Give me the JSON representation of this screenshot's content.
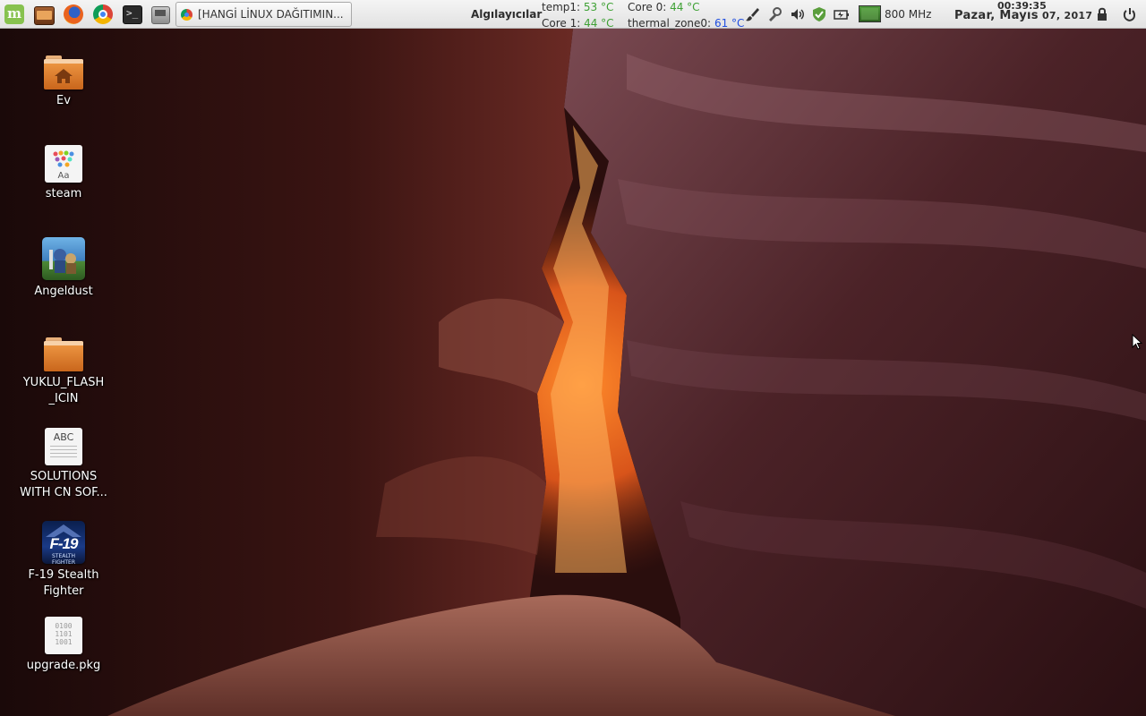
{
  "panel": {
    "launchers": [
      {
        "icon": "mint-menu-icon"
      },
      {
        "icon": "files-icon"
      },
      {
        "icon": "firefox-icon"
      },
      {
        "icon": "chrome-icon"
      },
      {
        "icon": "terminal-icon"
      },
      {
        "icon": "disk-icon"
      }
    ],
    "task": {
      "icon": "chrome-icon",
      "label": "[HANGİ LİNUX DAĞITIMIN..."
    },
    "sensors": {
      "title": "Algılayıcılar",
      "items": [
        {
          "name": "temp1:",
          "value": "53 °C",
          "color": "#3fa135"
        },
        {
          "name": "Core 1:",
          "value": "44 °C",
          "color": "#3fa135"
        },
        {
          "name": "Core 0:",
          "value": "44 °C",
          "color": "#3fa135"
        },
        {
          "name": "thermal_zone0:",
          "value": "61 °C",
          "color": "#1f4ee0"
        }
      ]
    },
    "tray": [
      "brush-icon",
      "settings-icon",
      "volume-icon",
      "shield-icon",
      "battery-icon",
      "cpu-graph-icon"
    ],
    "cpu_freq": "800 MHz",
    "clock": {
      "time": "00:39:35",
      "date_main": "Pazar, Mayıs",
      "date_small": " 07, 2017"
    },
    "end_icons": [
      "lock-icon",
      "power-icon"
    ]
  },
  "desktop": {
    "items": [
      {
        "label": "Ev",
        "icon": "home-folder-icon"
      },
      {
        "label": "steam",
        "icon": "font-file-icon",
        "icon_text": "Aa"
      },
      {
        "label": "Angeldust",
        "icon": "angeldust-icon"
      },
      {
        "label": "YUKLU_FLASH\n_ICIN",
        "icon": "folder-icon"
      },
      {
        "label": "SOLUTIONS\nWITH CN SOF...",
        "icon": "text-document-icon",
        "icon_text": "ABC"
      },
      {
        "label": "F-19 Stealth\nFighter",
        "icon": "f19-icon",
        "icon_text": "F-19",
        "icon_subtext": "STEALTH FIGHTER"
      },
      {
        "label": "upgrade.pkg",
        "icon": "binary-file-icon",
        "icon_text": "0100\n1101\n1001"
      }
    ]
  },
  "colors": {
    "panel_bg": "#ececec",
    "accent_mint": "#87c24f",
    "folder_orange": "#e5883a"
  }
}
